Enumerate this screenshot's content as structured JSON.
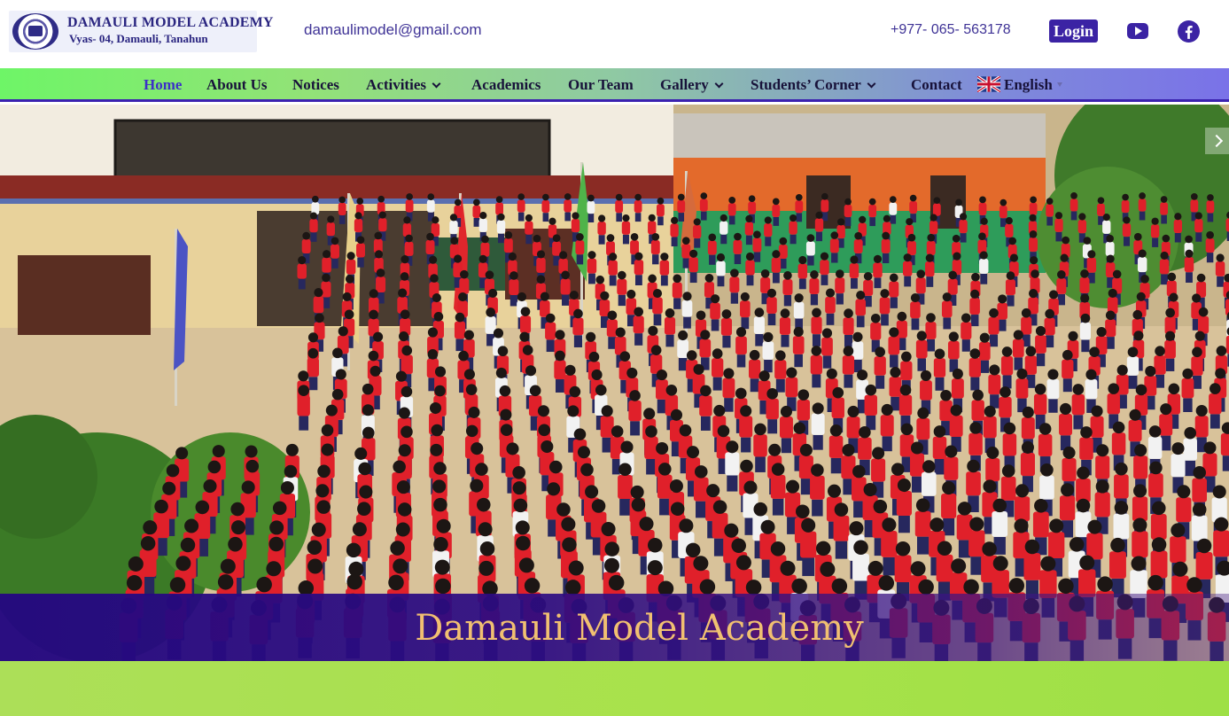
{
  "header": {
    "logo": {
      "name": "DAMAULI MODEL ACADEMY",
      "address": "Vyas- 04, Damauli, Tanahun"
    },
    "email": "damaulimodel@gmail.com",
    "phone": "+977- 065- 563178",
    "login_label": "Login",
    "social": [
      "youtube-icon",
      "facebook-icon"
    ]
  },
  "nav": {
    "items": [
      {
        "label": "Home",
        "active": true,
        "dropdown": false
      },
      {
        "label": "About Us",
        "active": false,
        "dropdown": false
      },
      {
        "label": "Notices",
        "active": false,
        "dropdown": false
      },
      {
        "label": "Activities",
        "active": false,
        "dropdown": true
      },
      {
        "label": "Academics",
        "active": false,
        "dropdown": false
      },
      {
        "label": "Our Team",
        "active": false,
        "dropdown": false
      },
      {
        "label": "Gallery",
        "active": false,
        "dropdown": true
      },
      {
        "label": "Students’ Corner",
        "active": false,
        "dropdown": true
      },
      {
        "label": "Contact",
        "active": false,
        "dropdown": false
      }
    ],
    "language": {
      "label": "English",
      "flag": "uk-flag-icon"
    }
  },
  "hero": {
    "title": "Damauli Model Academy"
  },
  "colors": {
    "brand": "#3b23a4",
    "title_gold": "#f1c071",
    "nav_text": "#18123a",
    "nav_active": "#3c2fc7",
    "bottom_band": "#a8e24a"
  }
}
